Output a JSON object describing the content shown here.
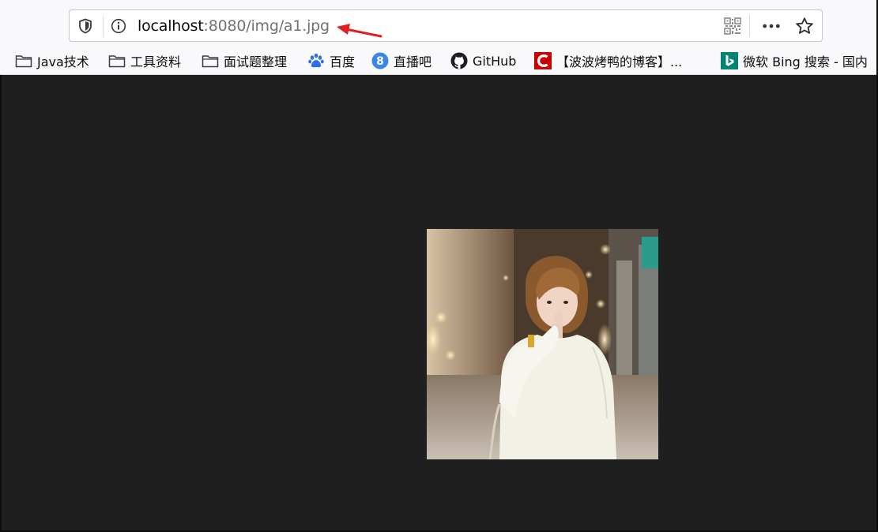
{
  "address_bar": {
    "url_host": "localhost",
    "url_rest": ":8080/img/a1.jpg"
  },
  "icons": {
    "shield": "tracking-protection-shield-icon",
    "info": "site-info-icon",
    "qr": "qr-code-icon",
    "more": "page-actions-menu-icon",
    "star": "bookmark-star-icon"
  },
  "bookmarks": [
    {
      "label": "Java技术",
      "icon": "folder-icon"
    },
    {
      "label": "工具资料",
      "icon": "folder-icon"
    },
    {
      "label": "面试题整理",
      "icon": "folder-icon"
    },
    {
      "label": "百度",
      "icon": "baidu-paw-icon"
    },
    {
      "label": "直播吧",
      "icon": "zhibo8-icon"
    },
    {
      "label": "GitHub",
      "icon": "github-icon"
    },
    {
      "label": "【波波烤鸭的博客】...",
      "icon": "csdn-icon"
    },
    {
      "label": "微软 Bing 搜索 - 国内",
      "icon": "bing-icon"
    }
  ],
  "colors": {
    "page_background": "#1f1f1f",
    "annotation_arrow": "#e02020",
    "csdn_red": "#c80000",
    "bing_teal": "#008373",
    "baidu_blue": "#2a6ee8",
    "zhibo8_blue": "#3b86e6"
  },
  "image_viewer": {
    "image_alt": "a1.jpg"
  }
}
